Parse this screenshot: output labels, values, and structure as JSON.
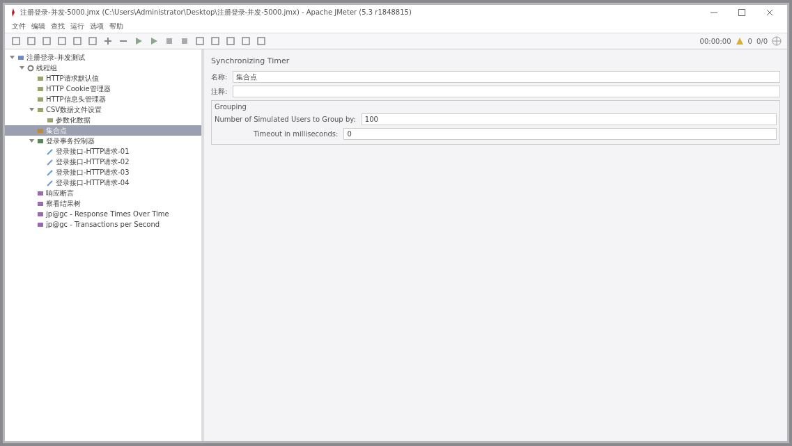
{
  "window": {
    "title": "注册登录-并发-5000.jmx (C:\\Users\\Administrator\\Desktop\\注册登录-并发-5000.jmx) - Apache JMeter (5.3 r1848815)"
  },
  "menu": [
    "文件",
    "编辑",
    "查找",
    "运行",
    "选项",
    "帮助"
  ],
  "toolbar_status": {
    "elapsed": "00:00:00",
    "warnings": "0",
    "threads": "0/0"
  },
  "tree": [
    {
      "label": "注册登录-并发测试",
      "kind": "plan",
      "expanded": true,
      "selected": false,
      "children": [
        {
          "label": "线程组",
          "kind": "group",
          "expanded": true,
          "selected": false,
          "children": [
            {
              "label": "HTTP请求默认值",
              "kind": "config",
              "selected": false
            },
            {
              "label": "HTTP Cookie管理器",
              "kind": "config",
              "selected": false
            },
            {
              "label": "HTTP信息头管理器",
              "kind": "config",
              "selected": false
            },
            {
              "label": "CSV数据文件设置",
              "kind": "config",
              "expanded": true,
              "selected": false,
              "children": [
                {
                  "label": "参数化数据",
                  "kind": "config",
                  "selected": false
                }
              ]
            },
            {
              "label": "集合点",
              "kind": "timer",
              "selected": true
            },
            {
              "label": "登录事务控制器",
              "kind": "controller",
              "expanded": true,
              "selected": false,
              "children": [
                {
                  "label": "登录接口-HTTP请求-01",
                  "kind": "sampler",
                  "selected": false
                },
                {
                  "label": "登录接口-HTTP请求-02",
                  "kind": "sampler",
                  "selected": false
                },
                {
                  "label": "登录接口-HTTP请求-03",
                  "kind": "sampler",
                  "selected": false
                },
                {
                  "label": "登录接口-HTTP请求-04",
                  "kind": "sampler",
                  "selected": false
                }
              ]
            },
            {
              "label": "响应断言",
              "kind": "listener",
              "selected": false
            },
            {
              "label": "察看结果树",
              "kind": "listener",
              "selected": false
            },
            {
              "label": "jp@gc - Response Times Over Time",
              "kind": "listener",
              "selected": false
            },
            {
              "label": "jp@gc - Transactions per Second",
              "kind": "listener",
              "selected": false
            }
          ]
        }
      ]
    }
  ],
  "panel": {
    "title": "Synchronizing Timer",
    "name_label": "名称:",
    "name_value": "集合点",
    "comment_label": "注释:",
    "section": "Grouping",
    "fields": [
      {
        "label": "Number of Simulated Users to Group by:",
        "value": "100"
      },
      {
        "label": "Timeout in milliseconds:",
        "value": "0"
      }
    ]
  }
}
